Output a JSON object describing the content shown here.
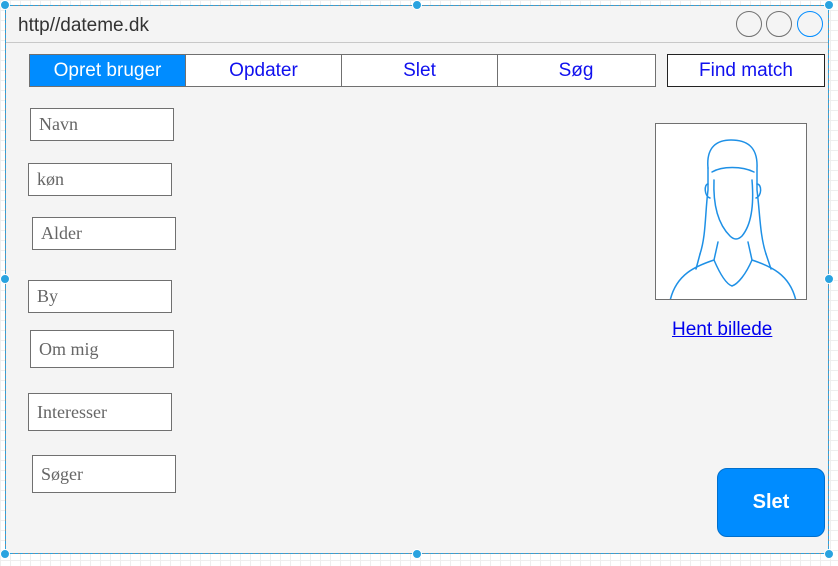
{
  "window": {
    "url": "http//dateme.dk"
  },
  "tabs": [
    {
      "label": "Opret bruger",
      "active": true
    },
    {
      "label": "Opdater",
      "active": false
    },
    {
      "label": "Slet",
      "active": false
    },
    {
      "label": "Søg",
      "active": false
    }
  ],
  "find_match_label": "Find match",
  "form": {
    "fields": [
      {
        "placeholder": "Navn"
      },
      {
        "placeholder": "køn"
      },
      {
        "placeholder": "Alder"
      },
      {
        "placeholder": "By"
      },
      {
        "placeholder": "Om mig"
      },
      {
        "placeholder": "Interesser"
      },
      {
        "placeholder": "Søger"
      }
    ]
  },
  "profile": {
    "photo_icon": "person-silhouette-icon",
    "fetch_link": "Hent billede"
  },
  "actions": {
    "delete_label": "Slet"
  },
  "colors": {
    "accent": "#008cff",
    "link": "#1010ee",
    "selection": "#29a3e0"
  }
}
